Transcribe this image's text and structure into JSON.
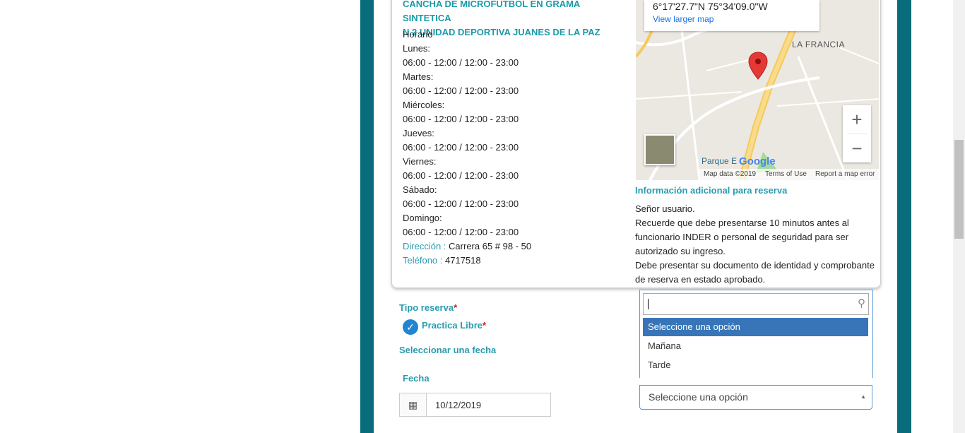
{
  "venue": {
    "title_line1": "CANCHA DE MICROFUTBOL EN GRAMA SINTETICA",
    "title_line2": "N.2 UNIDAD DEPORTIVA JUANES DE LA PAZ",
    "schedule_label": "Horario",
    "schedule": [
      {
        "day": "Lunes:",
        "hours": "06:00 - 12:00  /  12:00 - 23:00"
      },
      {
        "day": "Martes:",
        "hours": "06:00 - 12:00  /  12:00 - 23:00"
      },
      {
        "day": "Miércoles:",
        "hours": "06:00 - 12:00  /  12:00 - 23:00"
      },
      {
        "day": "Jueves:",
        "hours": "06:00 - 12:00  /  12:00 - 23:00"
      },
      {
        "day": "Viernes:",
        "hours": "06:00 - 12:00  /  12:00 - 23:00"
      },
      {
        "day": "Sábado:",
        "hours": "06:00 - 12:00  /  12:00 - 23:00"
      },
      {
        "day": "Domingo:",
        "hours": "06:00 - 12:00  /  12:00 - 23:00"
      }
    ],
    "address_label": "Dirección :",
    "address": "Carrera 65 # 98 - 50",
    "phone_label": "Teléfono :",
    "phone": "4717518"
  },
  "map": {
    "coords": "6°17'27.7\"N 75°34'09.0\"W",
    "larger_map": "View larger map",
    "place_label": "LA FRANCIA",
    "park_label": "Parque E",
    "google": "Google",
    "footer_data": "Map data ©2019",
    "footer_terms": "Terms of Use",
    "footer_report": "Report a map error",
    "zoom_in": "+",
    "zoom_out": "−"
  },
  "info": {
    "title": "Información adicional para reserva",
    "lines": [
      "Señor usuario.",
      "Recuerde que debe presentarse 10 minutos antes al",
      "funcionario INDER o personal de seguridad para ser",
      "autorizado su ingreso.",
      "Debe presentar su documento de identidad y comprobante",
      "de reserva en estado aprobado."
    ]
  },
  "form": {
    "tipo_label": "Tipo reserva",
    "required_mark": "*",
    "option_label": "Practica Libre",
    "select_date_label": "Seleccionar una fecha",
    "fecha_label": "Fecha",
    "fecha_value": "10/12/2019",
    "select_placeholder": "Seleccione una opción",
    "dropdown_options": [
      "Seleccione una opción",
      "Mañana",
      "Tarde"
    ]
  },
  "colors": {
    "frame": "#086c7a",
    "accent": "#2a9bb0",
    "selected_option": "#3875b8"
  }
}
